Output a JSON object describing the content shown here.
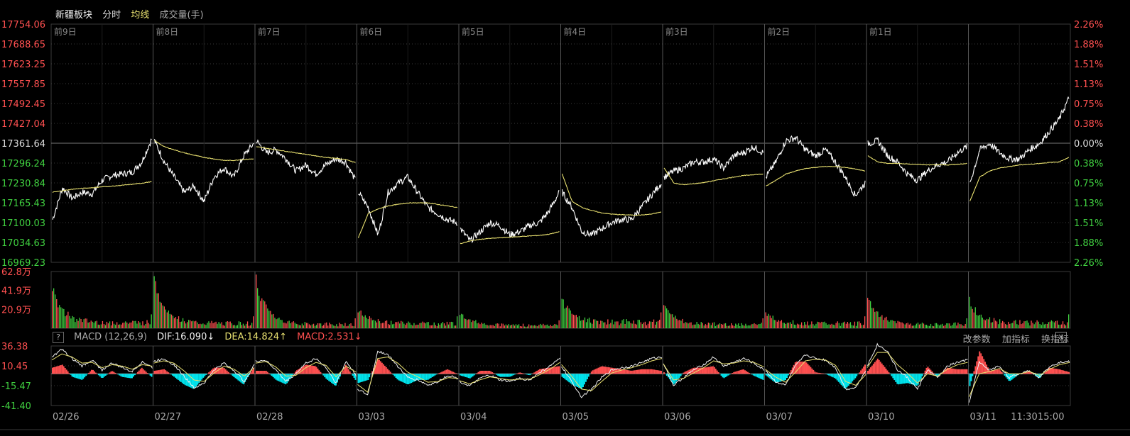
{
  "header": {
    "name": "新疆板块",
    "period": "分时",
    "ma_label": "均线",
    "vol_label": "成交量(手)"
  },
  "macd_header": {
    "help": "?",
    "title": "MACD (12,26,9)",
    "dif": "DIF:16.090↓",
    "dea": "DEA:14.824↑",
    "macd": "MACD:2.531↓",
    "buttons": [
      "改参数",
      "加指标",
      "换指标"
    ],
    "close": "✕"
  },
  "colors": {
    "up": "#ff5050",
    "down": "#40d040",
    "price": "#ffffff",
    "avg": "#e8e070",
    "cyan": "#00e5ee",
    "grid": "#3a3a3a",
    "dateSep": "#555555"
  },
  "chart_data": [
    {
      "type": "line",
      "panel": "price",
      "y_axis_left": [
        "17754.06",
        "17688.65",
        "17623.25",
        "17557.85",
        "17492.45",
        "17427.04",
        "17361.64",
        "17296.24",
        "17230.84",
        "17165.43",
        "17100.03",
        "17034.63",
        "16969.23"
      ],
      "y_axis_right": [
        "2.26%",
        "1.88%",
        "1.51%",
        "1.13%",
        "0.75%",
        "0.38%",
        "0.00%",
        "0.38%",
        "0.75%",
        "1.13%",
        "1.51%",
        "1.88%",
        "2.26%"
      ],
      "ylim": [
        16969.23,
        17754.06
      ],
      "base_close": 17361.64,
      "day_labels": [
        "前9日",
        "前8日",
        "前7日",
        "前6日",
        "前5日",
        "前4日",
        "前3日",
        "前2日",
        "前1日",
        ""
      ],
      "series": [
        {
          "key": "price",
          "days": [
            {
              "open": 17110,
              "points": [
                17110,
                17215,
                17180,
                17200,
                17195,
                17240,
                17255,
                17260,
                17265,
                17300,
                17375
              ]
            },
            {
              "open": 17375,
              "points": [
                17370,
                17300,
                17250,
                17200,
                17220,
                17170,
                17250,
                17280,
                17250,
                17320,
                17360
              ]
            },
            {
              "open": 17360,
              "points": [
                17370,
                17330,
                17340,
                17310,
                17270,
                17290,
                17260,
                17290,
                17310,
                17300,
                17240
              ]
            },
            {
              "open": 17240,
              "points": [
                17200,
                17150,
                17060,
                17200,
                17230,
                17250,
                17200,
                17150,
                17130,
                17110,
                17100
              ]
            },
            {
              "open": 17100,
              "points": [
                17080,
                17040,
                17070,
                17100,
                17090,
                17060,
                17070,
                17090,
                17100,
                17140,
                17200
              ]
            },
            {
              "open": 17270,
              "points": [
                17200,
                17150,
                17070,
                17060,
                17080,
                17100,
                17110,
                17110,
                17150,
                17190,
                17230
              ]
            },
            {
              "open": 17290,
              "points": [
                17250,
                17270,
                17280,
                17300,
                17300,
                17310,
                17280,
                17320,
                17330,
                17350,
                17330
              ]
            },
            {
              "open": 17235,
              "points": [
                17250,
                17300,
                17370,
                17380,
                17340,
                17320,
                17340,
                17300,
                17250,
                17190,
                17230
              ]
            },
            {
              "open": 17340,
              "points": [
                17360,
                17370,
                17320,
                17300,
                17260,
                17240,
                17270,
                17290,
                17300,
                17330,
                17350
              ]
            },
            {
              "open": 17180,
              "points": [
                17230,
                17340,
                17360,
                17330,
                17310,
                17310,
                17340,
                17360,
                17400,
                17440,
                17510
              ]
            }
          ]
        },
        {
          "key": "avg",
          "days": [
            {
              "points": [
                17200,
                17205,
                17210,
                17213,
                17215,
                17218,
                17220,
                17223,
                17226,
                17230,
                17235
              ]
            },
            {
              "points": [
                17370,
                17350,
                17340,
                17330,
                17322,
                17315,
                17310,
                17305,
                17305,
                17308,
                17310
              ]
            },
            {
              "points": [
                17350,
                17345,
                17340,
                17335,
                17330,
                17325,
                17320,
                17315,
                17312,
                17308,
                17298
              ]
            },
            {
              "points": [
                17050,
                17130,
                17145,
                17155,
                17160,
                17165,
                17165,
                17165,
                17160,
                17155,
                17150
              ]
            },
            {
              "points": [
                17030,
                17040,
                17045,
                17048,
                17050,
                17052,
                17054,
                17056,
                17058,
                17062,
                17070
              ]
            },
            {
              "points": [
                17260,
                17170,
                17150,
                17140,
                17132,
                17128,
                17126,
                17125,
                17125,
                17128,
                17135
              ]
            },
            {
              "points": [
                17280,
                17230,
                17225,
                17228,
                17232,
                17238,
                17244,
                17250,
                17255,
                17258,
                17260
              ]
            },
            {
              "points": [
                17220,
                17240,
                17260,
                17270,
                17278,
                17282,
                17285,
                17285,
                17282,
                17277,
                17270
              ]
            },
            {
              "points": [
                17320,
                17300,
                17295,
                17295,
                17293,
                17292,
                17290,
                17290,
                17290,
                17292,
                17295
              ]
            },
            {
              "points": [
                17170,
                17250,
                17270,
                17280,
                17285,
                17290,
                17292,
                17295,
                17298,
                17300,
                17315
              ]
            }
          ]
        }
      ]
    },
    {
      "type": "bar",
      "panel": "volume",
      "y_axis": [
        "62.8万",
        "41.9万",
        "20.9万"
      ],
      "ylim_wan": [
        0,
        62.8
      ],
      "day_peaks_wan": [
        50,
        62.8,
        62.8,
        25,
        22,
        37,
        32,
        20,
        42,
        34
      ],
      "day_bases_wan": [
        7,
        6,
        5,
        6,
        4,
        8,
        5,
        6,
        5,
        7
      ]
    },
    {
      "type": "bar",
      "panel": "macd",
      "y_axis": [
        "36.38",
        "10.45",
        "-15.47",
        "-41.40"
      ],
      "ylim": [
        -41.4,
        36.38
      ],
      "x_labels": [
        "02/26",
        "02/27",
        "02/28",
        "03/03",
        "03/04",
        "03/05",
        "03/06",
        "03/07",
        "03/10",
        "03/11",
        "11:30",
        "15:00"
      ],
      "dif_days": [
        [
          22,
          32,
          20,
          10,
          18,
          5,
          14,
          8,
          3,
          16,
          8
        ],
        [
          16,
          20,
          12,
          -3,
          -18,
          -12,
          5,
          14,
          4,
          -10,
          12
        ],
        [
          16,
          18,
          5,
          -10,
          0,
          14,
          20,
          8,
          -12,
          16,
          -2
        ],
        [
          -20,
          -28,
          30,
          25,
          10,
          -5,
          -8,
          -15,
          -10,
          -2,
          -6
        ],
        [
          -10,
          -16,
          -6,
          -2,
          -8,
          -10,
          -6,
          -8,
          2,
          10,
          20
        ],
        [
          10,
          -10,
          -30,
          -20,
          -5,
          5,
          8,
          10,
          15,
          20,
          22
        ],
        [
          14,
          -15,
          -5,
          5,
          12,
          22,
          10,
          15,
          20,
          14,
          5
        ],
        [
          5,
          -10,
          -15,
          10,
          25,
          20,
          18,
          8,
          -20,
          -18,
          5
        ],
        [
          10,
          38,
          30,
          5,
          -5,
          -20,
          5,
          -5,
          10,
          15,
          18
        ],
        [
          -38,
          15,
          5,
          10,
          -5,
          0,
          5,
          -5,
          10,
          15,
          16
        ]
      ],
      "dea_days": [
        [
          18,
          26,
          22,
          14,
          15,
          8,
          12,
          10,
          6,
          12,
          10
        ],
        [
          14,
          17,
          14,
          4,
          -8,
          -10,
          1,
          10,
          6,
          -3,
          8
        ],
        [
          14,
          16,
          9,
          -3,
          -2,
          8,
          15,
          11,
          -4,
          10,
          2
        ],
        [
          -14,
          -24,
          20,
          22,
          14,
          2,
          -4,
          -11,
          -10,
          -5,
          -6
        ],
        [
          -9,
          -13,
          -8,
          -4,
          -6,
          -8,
          -7,
          -7,
          -1,
          6,
          15
        ],
        [
          12,
          -3,
          -20,
          -22,
          -10,
          1,
          5,
          8,
          12,
          17,
          20
        ],
        [
          13,
          -8,
          -6,
          1,
          8,
          17,
          13,
          14,
          17,
          15,
          9
        ],
        [
          6,
          -4,
          -11,
          2,
          17,
          19,
          18,
          11,
          -10,
          -15,
          -1
        ],
        [
          8,
          28,
          28,
          12,
          1,
          -12,
          0,
          -3,
          6,
          12,
          15
        ],
        [
          -30,
          0,
          3,
          7,
          0,
          0,
          3,
          -2,
          6,
          12,
          14.8
        ]
      ]
    }
  ]
}
